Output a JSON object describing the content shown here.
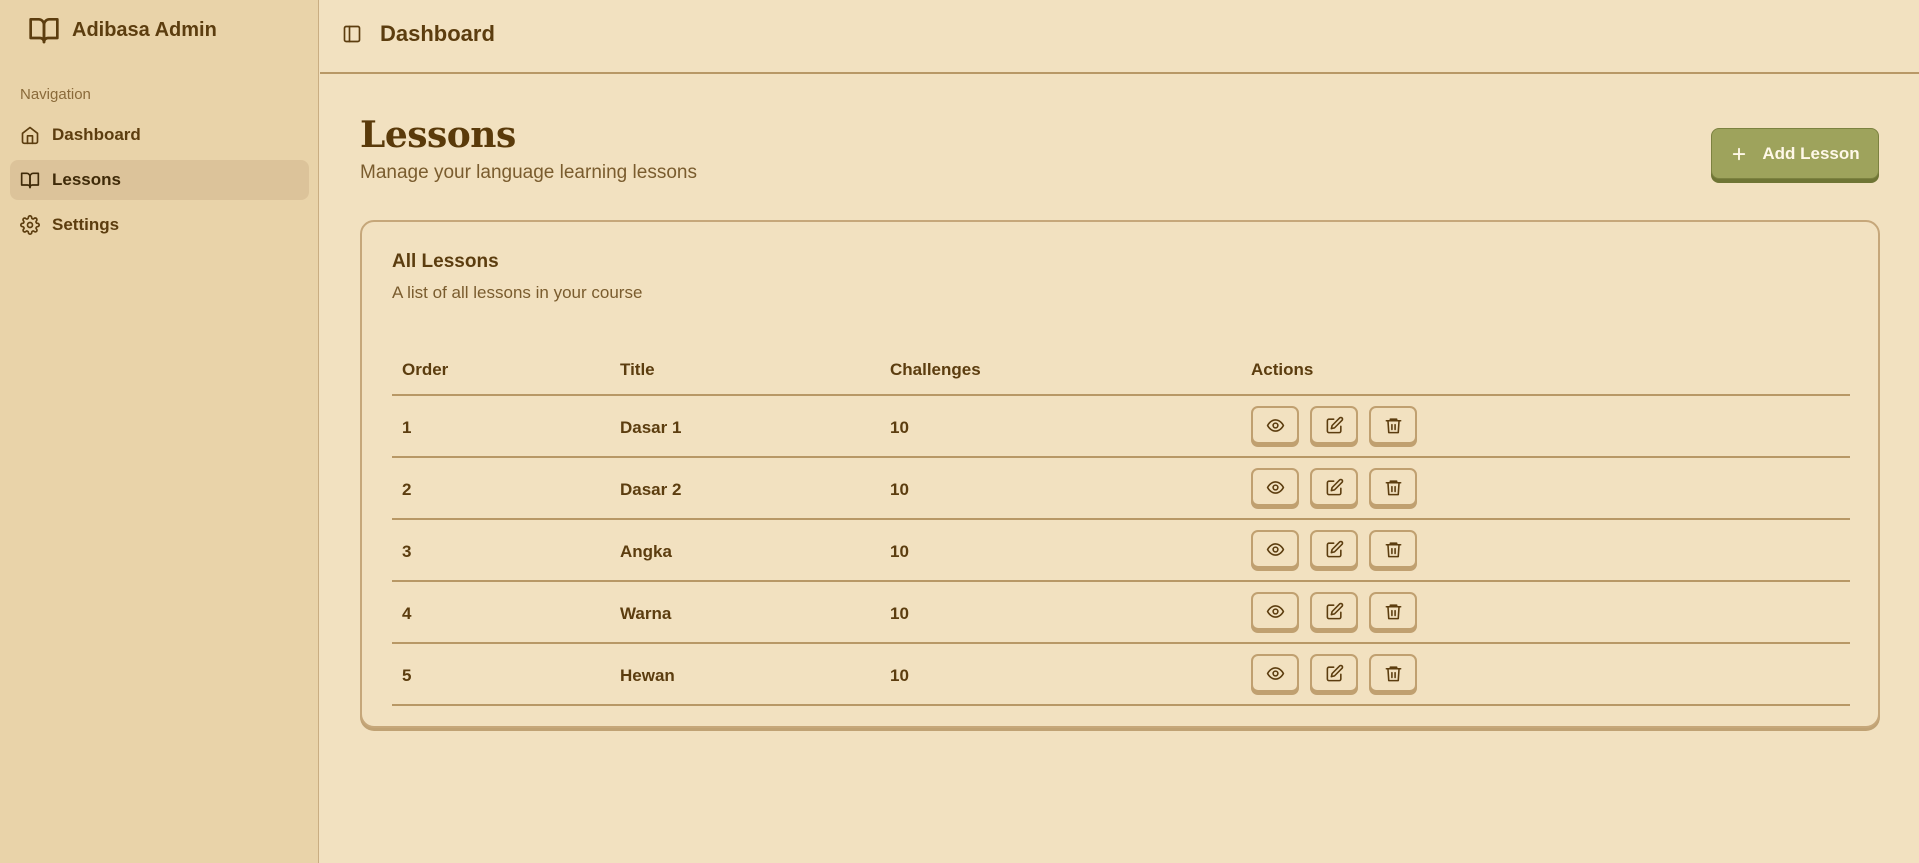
{
  "sidebar": {
    "brand": "Adibasa Admin",
    "nav_heading": "Navigation",
    "items": [
      {
        "label": "Dashboard",
        "icon": "home-icon"
      },
      {
        "label": "Lessons",
        "icon": "book-icon",
        "active": true
      },
      {
        "label": "Settings",
        "icon": "gear-icon"
      }
    ]
  },
  "header": {
    "title": "Dashboard",
    "toggle_icon": "sidebar-toggle-icon"
  },
  "main": {
    "title": "Lessons",
    "subtitle": "Manage your language learning lessons",
    "add_button": {
      "label": "Add Lesson",
      "icon": "plus-icon"
    }
  },
  "card": {
    "title": "All Lessons",
    "description": "A list of all lessons in your course",
    "columns": [
      "Order",
      "Title",
      "Challenges",
      "Actions"
    ],
    "rows": [
      {
        "order": "1",
        "title": "Dasar 1",
        "challenges": "10"
      },
      {
        "order": "2",
        "title": "Dasar 2",
        "challenges": "10"
      },
      {
        "order": "3",
        "title": "Angka",
        "challenges": "10"
      },
      {
        "order": "4",
        "title": "Warna",
        "challenges": "10"
      },
      {
        "order": "5",
        "title": "Hewan",
        "challenges": "10"
      }
    ],
    "row_actions": [
      "eye-icon",
      "edit-icon",
      "trash-icon"
    ]
  },
  "colors": {
    "background": "#f2e1c0",
    "sidebar": "#e9d3a9",
    "accent": "#9ea35c",
    "text": "#5c3d0f"
  }
}
